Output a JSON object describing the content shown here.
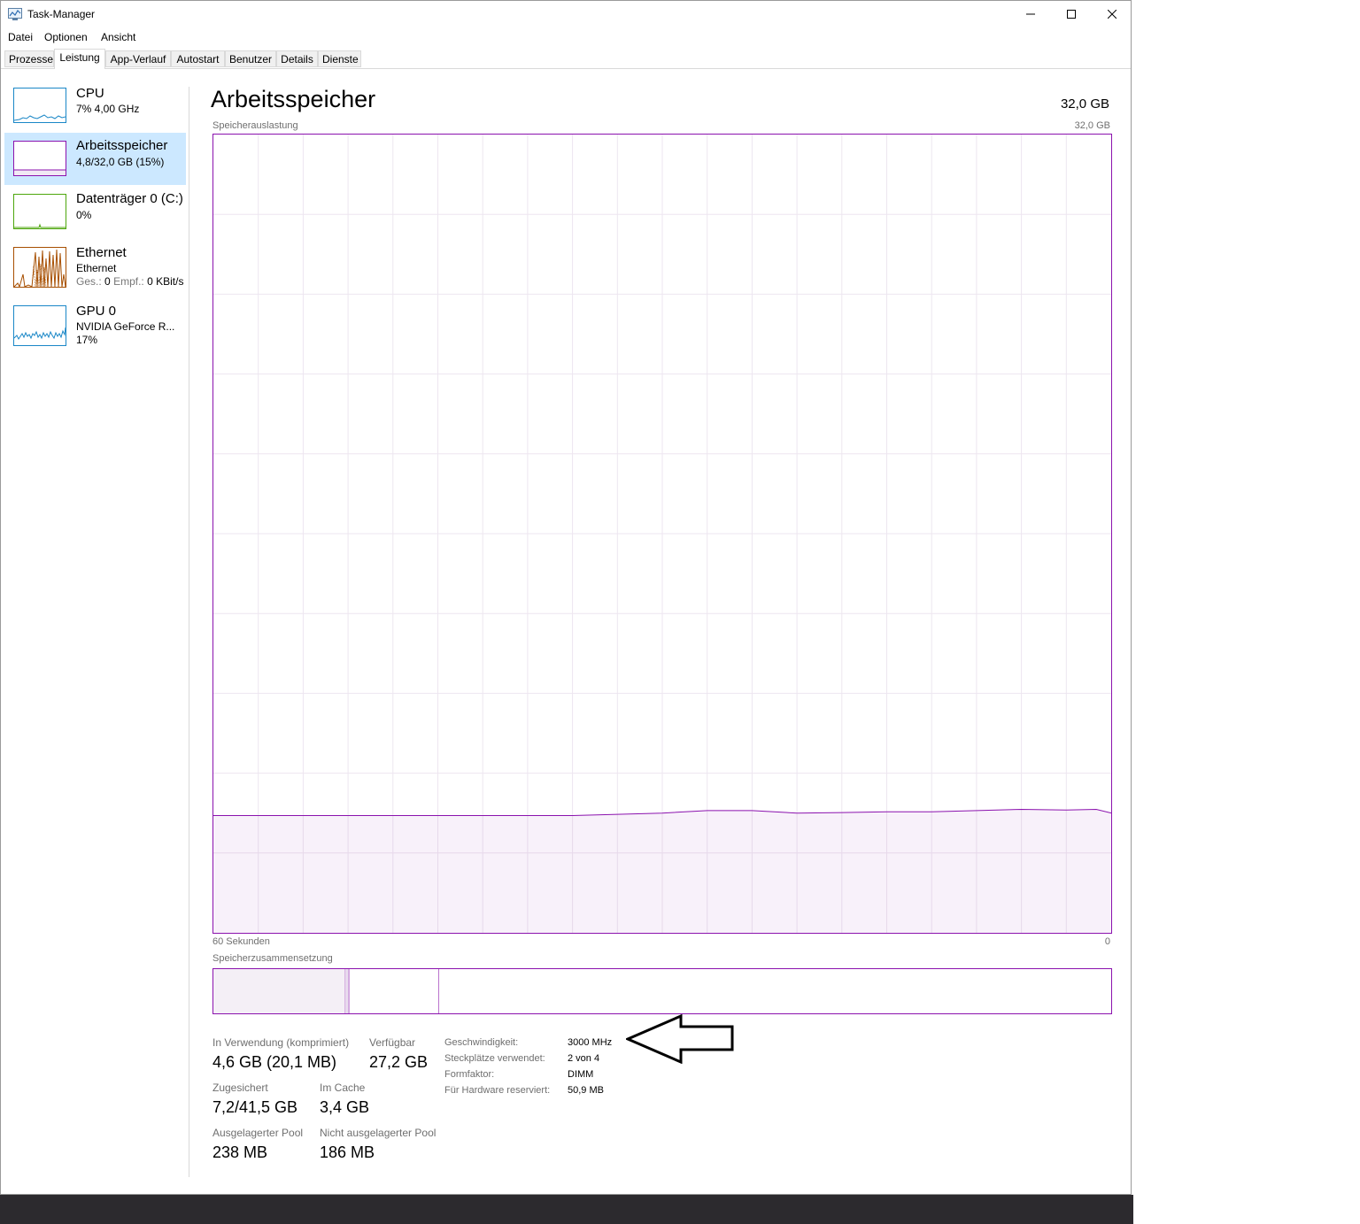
{
  "window": {
    "title": "Task-Manager"
  },
  "menu": [
    "Datei",
    "Optionen",
    "Ansicht"
  ],
  "tabs": [
    {
      "label": "Prozesse",
      "active": false
    },
    {
      "label": "Leistung",
      "active": true
    },
    {
      "label": "App-Verlauf",
      "active": false
    },
    {
      "label": "Autostart",
      "active": false
    },
    {
      "label": "Benutzer",
      "active": false
    },
    {
      "label": "Details",
      "active": false
    },
    {
      "label": "Dienste",
      "active": false
    }
  ],
  "sidebar": {
    "items": [
      {
        "title": "CPU",
        "sub": "7%  4,00 GHz",
        "color": "#1a87c7",
        "selected": false
      },
      {
        "title": "Arbeitsspeicher",
        "sub": "4,8/32,0 GB (15%)",
        "color": "#8b12ae",
        "selected": true
      },
      {
        "title": "Datenträger 0 (C:)",
        "sub": "0%",
        "color": "#4da60c",
        "selected": false
      },
      {
        "title": "Ethernet",
        "sub": "Ethernet",
        "sub2_send_label": "Ges.:",
        "sub2_send_value": "0",
        "sub2_recv_label": "Empf.:",
        "sub2_recv_value": "0 KBit/s",
        "color": "#a74f01",
        "selected": false
      },
      {
        "title": "GPU 0",
        "sub": "NVIDIA GeForce R...",
        "sub2": "17%",
        "color": "#1a87c7",
        "selected": false
      }
    ]
  },
  "main": {
    "title": "Arbeitsspeicher",
    "capacity": "32,0 GB",
    "graph_label": "Speicherauslastung",
    "graph_max": "32,0 GB",
    "graph_time_left": "60 Sekunden",
    "graph_time_right": "0",
    "composition_label": "Speicherzusammensetzung"
  },
  "chart_data": {
    "type": "area",
    "ylim": [
      0,
      32
    ],
    "grid": true,
    "x": [
      60,
      57,
      54,
      51,
      48,
      45,
      42,
      39,
      36,
      33,
      30,
      27,
      24,
      21,
      18,
      15,
      12,
      9,
      6,
      3,
      1,
      0
    ],
    "values": [
      4.7,
      4.7,
      4.7,
      4.7,
      4.7,
      4.7,
      4.7,
      4.7,
      4.7,
      4.75,
      4.8,
      4.9,
      4.9,
      4.8,
      4.82,
      4.85,
      4.85,
      4.9,
      4.95,
      4.92,
      4.95,
      4.8
    ],
    "color": "#8b12ae"
  },
  "composition": {
    "in_use_fraction": 0.147,
    "modified_fraction": 0.004,
    "standby_fraction": 0.1,
    "color": "#8b12ae"
  },
  "stats": {
    "in_use_label": "In Verwendung (komprimiert)",
    "in_use_value": "4,6 GB (20,1 MB)",
    "available_label": "Verfügbar",
    "available_value": "27,2 GB",
    "committed_label": "Zugesichert",
    "committed_value": "7,2/41,5 GB",
    "cached_label": "Im Cache",
    "cached_value": "3,4 GB",
    "paged_label": "Ausgelagerter Pool",
    "paged_value": "238 MB",
    "nonpaged_label": "Nicht ausgelagerter Pool",
    "nonpaged_value": "186 MB"
  },
  "specs": [
    {
      "label": "Geschwindigkeit:",
      "value": "3000 MHz"
    },
    {
      "label": "Steckplätze verwendet:",
      "value": "2 von 4"
    },
    {
      "label": "Formfaktor:",
      "value": "DIMM"
    },
    {
      "label": "Für Hardware reserviert:",
      "value": "50,9 MB"
    }
  ]
}
